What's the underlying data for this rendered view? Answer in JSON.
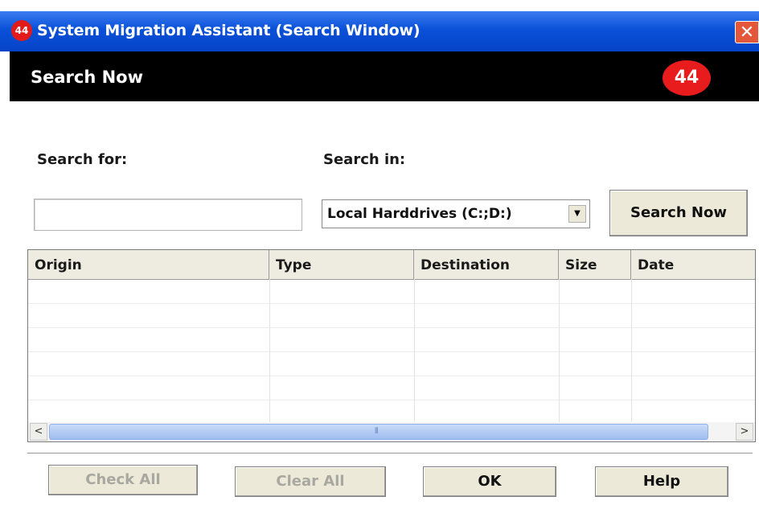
{
  "window": {
    "title": "System Migration Assistant (Search Window)",
    "logo_text": "44",
    "close_symbol": "✕"
  },
  "header": {
    "title": "Search Now",
    "logo_text": "44"
  },
  "search": {
    "search_for_label": "Search for:",
    "search_for_value": "",
    "search_in_label": "Search in:",
    "search_in_value": "Local Harddrives (C:;D:)",
    "search_button": "Search Now"
  },
  "results": {
    "columns": [
      "Origin",
      "Type",
      "Destination",
      "Size",
      "Date"
    ],
    "rows": []
  },
  "scrollbar": {
    "left_arrow": "<",
    "right_arrow": ">",
    "grip": "⦀"
  },
  "footer": {
    "check_all": "Check All",
    "clear_all": "Clear All",
    "ok": "OK",
    "help": "Help"
  },
  "colors": {
    "title_bar": "#0a50d8",
    "header_bar": "#000000",
    "brand_red": "#e21a1a",
    "button_face": "#ece9d8"
  },
  "icons": {
    "app_logo": "company-logo-icon",
    "close": "close-icon",
    "dropdown": "chevron-down-icon"
  }
}
